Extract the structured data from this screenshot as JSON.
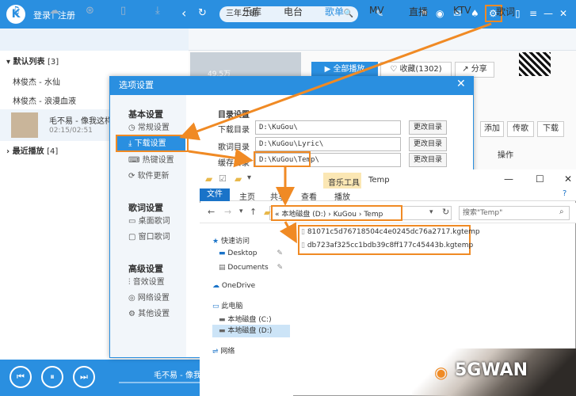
{
  "topbar": {
    "logo": "K",
    "login": "登录",
    "separator": "|",
    "register": "注册",
    "search_value": "三年二班",
    "back": "‹",
    "refresh": "↻",
    "forward": "›",
    "search_icon": "🔍"
  },
  "nav_tabs": [
    "乐库",
    "电台",
    "歌单",
    "MV",
    "直播",
    "KTV",
    "歌词"
  ],
  "left": {
    "default_list": "默认列表",
    "default_count": "[3]",
    "songs": [
      "林俊杰 - 水仙",
      "林俊杰 - 浪漫血液"
    ],
    "now_playing": "毛不易 - 像我这样",
    "now_time": "02:15/02:51",
    "recent": "最近播放",
    "recent_count": "[4]"
  },
  "content": {
    "play_count": "49.5万",
    "play_all": "全部播放",
    "favorite": "收藏(1302)",
    "share": "分享",
    "btn_add": "添加",
    "btn_send": "传歌",
    "btn_download": "下载",
    "col_ops": "操作"
  },
  "dialog": {
    "title": "选项设置",
    "close": "✕",
    "groups": [
      {
        "head": "基本设置",
        "items": [
          "常规设置",
          "下载设置",
          "热键设置",
          "软件更新"
        ]
      },
      {
        "head": "歌词设置",
        "items": [
          "桌面歌词",
          "窗口歌词"
        ]
      },
      {
        "head": "高级设置",
        "items": [
          "音效设置",
          "网络设置",
          "其他设置"
        ]
      }
    ],
    "section": "目录设置",
    "fields": [
      {
        "label": "下载目录",
        "value": "D:\\KuGou\\",
        "button": "更改目录"
      },
      {
        "label": "歌词目录",
        "value": "D:\\KuGou\\Lyric\\",
        "button": "更改目录"
      },
      {
        "label": "缓存目录",
        "value": "D:\\KuGou\\Temp\\",
        "button": "更改目录"
      }
    ]
  },
  "explorer": {
    "title": "Temp",
    "music_tools": "音乐工具",
    "ribbon": [
      "文件",
      "主页",
      "共享",
      "查看",
      "播放"
    ],
    "address": [
      "«",
      "本地磁盘 (D:)",
      "›",
      "KuGou",
      "›",
      "Temp"
    ],
    "search_placeholder": "搜索\"Temp\"",
    "tree": [
      "快速访问",
      "Desktop",
      "Documents",
      "OneDrive",
      "此电脑",
      "本地磁盘 (C:)",
      "本地磁盘 (D:)",
      "网络"
    ],
    "files": [
      "81071c5d76718504c4e0245dc76a2717.kgtemp",
      "db723af325cc1bdb39c8ff177c45443b.kgtemp"
    ],
    "min": "—",
    "max": "☐",
    "close": "✕"
  },
  "player": {
    "prev": "⏮",
    "pause": "⏸",
    "next": "⏭",
    "track": "毛不易 - 像我"
  },
  "watermark": "5GWAN",
  "colors": {
    "accent": "#2a8fe0",
    "highlight": "#f08a24",
    "explorer_file": "#1a73c8"
  }
}
